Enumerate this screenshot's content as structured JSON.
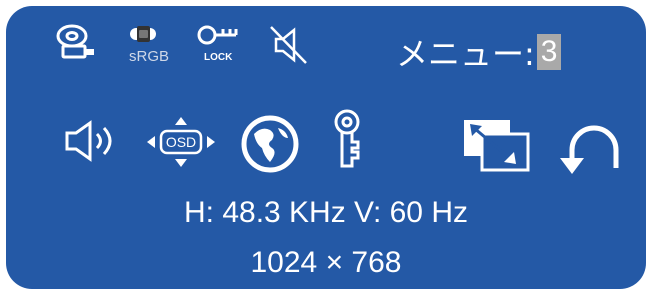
{
  "status": {
    "srgb_label": "sRGB",
    "lock_label": "LOCK"
  },
  "menu": {
    "title_label": "メニュー:",
    "number": "3"
  },
  "signal": {
    "frequency_text": "H: 48.3 KHz  V: 60 Hz",
    "resolution_text": "1024 × 768"
  },
  "icons": [
    "input-source-icon",
    "srgb-mode-icon",
    "key-lock-icon",
    "mute-icon",
    "volume-icon",
    "osd-position-icon",
    "language-globe-icon",
    "key-icon",
    "image-adjust-icon",
    "reset-return-icon"
  ],
  "colors": {
    "background": "#2459a6",
    "foreground": "#ffffff",
    "highlight": "#a9a9a9"
  }
}
